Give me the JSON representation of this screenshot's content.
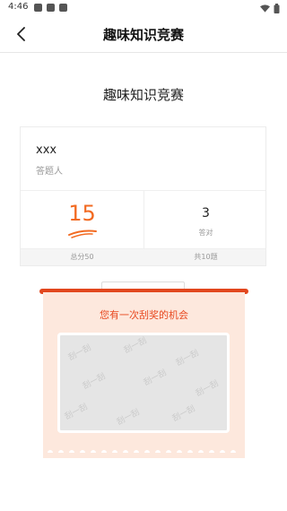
{
  "status_bar": {
    "time": "4:46"
  },
  "nav": {
    "title": "趣味知识竞赛",
    "back_icon": "chevron-left-icon"
  },
  "page": {
    "title": "趣味知识竞赛"
  },
  "result": {
    "user_name": "xxx",
    "user_role": "答题人",
    "score": "15",
    "correct_count": "3",
    "correct_label": "答对",
    "total_score_label": "总分50",
    "question_count_label": "共10题"
  },
  "analysis_button": {
    "label": "查看答题解析",
    "icon": "double-chevron-down-icon"
  },
  "scratch_card": {
    "title": "您有一次刮奖的机会",
    "pattern_text": "刮一刮"
  },
  "colors": {
    "accent": "#f26a21",
    "ticket_bar": "#e2471e",
    "ticket_bg": "#fde8dd",
    "scratch_title": "#e8481f"
  }
}
